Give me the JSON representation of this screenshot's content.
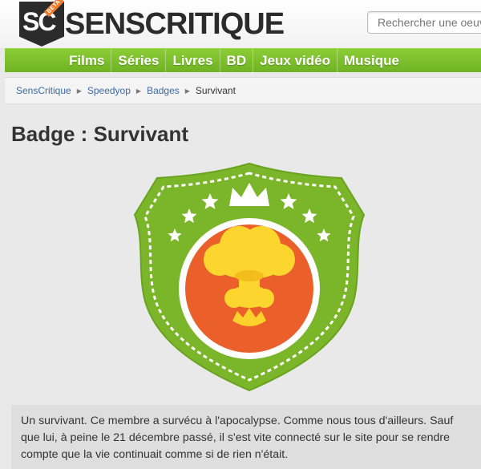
{
  "logo": {
    "mark_text": "SC",
    "beta_label": "BETA",
    "wordmark": "SENSCRITIQUE"
  },
  "search": {
    "placeholder": "Rechercher une oeuvre"
  },
  "nav": {
    "items": [
      "Films",
      "Séries",
      "Livres",
      "BD",
      "Jeux vidéo",
      "Musique"
    ]
  },
  "breadcrumb": {
    "items": [
      "SensCritique",
      "Speedyop",
      "Badges"
    ],
    "current": "Survivant",
    "separator": "▶"
  },
  "page": {
    "title": "Badge : Survivant"
  },
  "badge": {
    "icon": "mushroom-cloud-icon",
    "colors": {
      "shield": "#7ab52a",
      "shield_border": "#6aa320",
      "circle_ring": "#ffffff",
      "circle_fill": "#ea5f2a",
      "cloud": "#fcd62f",
      "cloud_shade": "#f3bd1c",
      "flame": "#fdd12b",
      "stars": "#ffffff"
    }
  },
  "description": {
    "text": "Un survivant. Ce membre a survécu à l'apocalypse. Comme nous tous d'ailleurs. Sauf que lui, à peine le 21 décembre passé, il s'est vite connecté sur le site pour se rendre compte que la vie continuait comme si de rien n'était."
  },
  "colors": {
    "accent_green": "#7ab52a",
    "link_blue": "#3d6aa0",
    "background": "#e9e9e9"
  }
}
